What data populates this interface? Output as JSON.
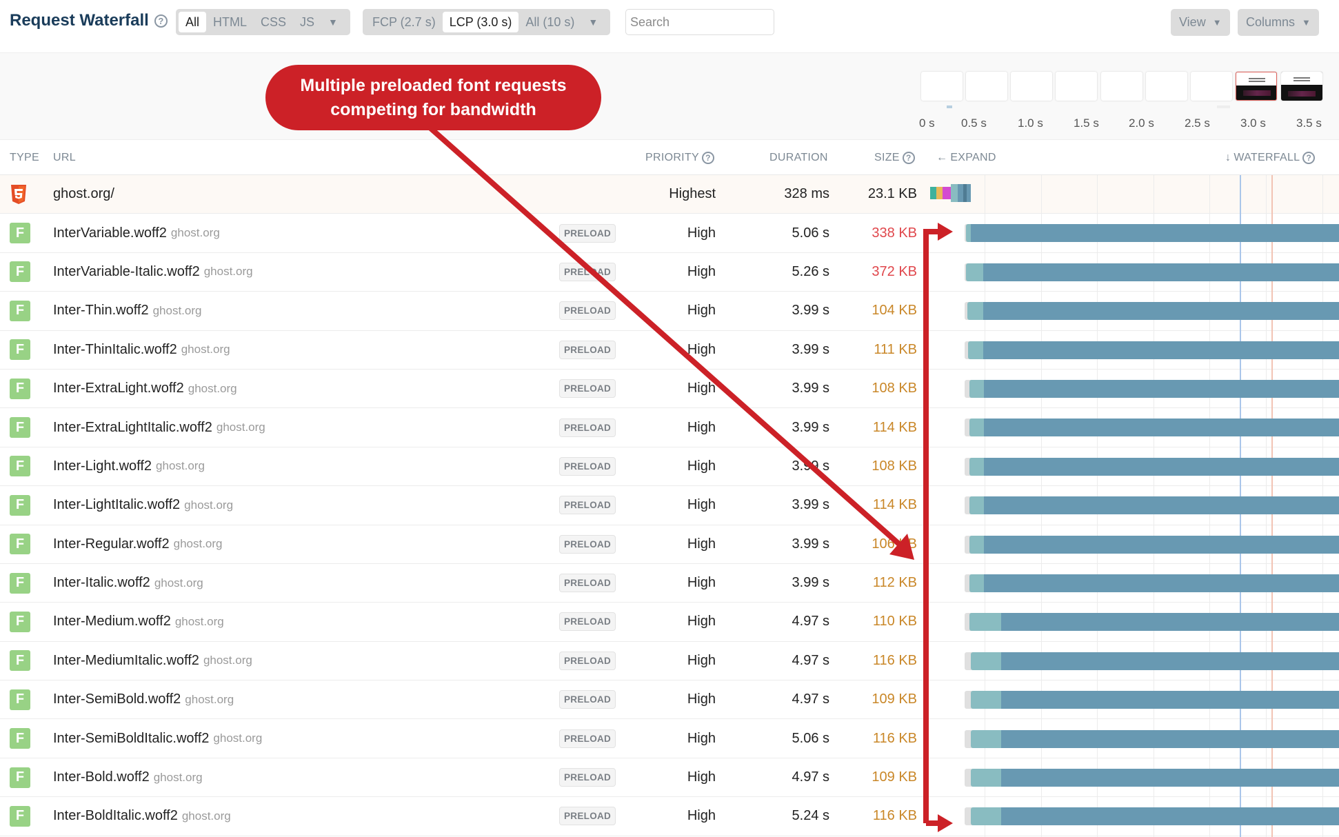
{
  "header": {
    "title": "Request Waterfall",
    "type_filters": [
      "All",
      "HTML",
      "CSS",
      "JS"
    ],
    "type_filter_active": "All",
    "time_filters": [
      "FCP (2.7 s)",
      "LCP (3.0 s)",
      "All (10 s)"
    ],
    "time_filter_active": "LCP (3.0 s)",
    "search_placeholder": "Search",
    "view_label": "View",
    "columns_label": "Columns"
  },
  "filmstrip": {
    "ticks": [
      "0 s",
      "0.5 s",
      "1.0 s",
      "1.5 s",
      "2.0 s",
      "2.5 s",
      "3.0 s",
      "3.5 s"
    ],
    "frames": [
      "blank",
      "blank",
      "blank",
      "blank",
      "blank",
      "blank",
      "blank",
      "screenshot-lcp",
      "screenshot"
    ]
  },
  "columns": {
    "type": "TYPE",
    "url": "URL",
    "priority": "PRIORITY",
    "duration": "DURATION",
    "size": "SIZE",
    "expand": "EXPAND",
    "waterfall": "WATERFALL"
  },
  "colors": {
    "annotation": "#cc2127",
    "size_large": "#e0474c",
    "size_medium": "#c98728",
    "bar_connect": "#89bcc1",
    "bar_download": "#6899b2",
    "fcp_line": "#aac6ea",
    "lcp_line": "#f2c4b4"
  },
  "waterfall": {
    "axis_max_s": 3.6,
    "fcp_s": 2.7,
    "lcp_s": 3.0
  },
  "rows": [
    {
      "type": "html",
      "name": "ghost.org/",
      "host": "",
      "badge": "",
      "priority": "Highest",
      "duration": "328 ms",
      "size": "23.1 KB",
      "size_level": "normal",
      "start_s": 0.0,
      "wait_s": 0.0,
      "connect_s": 0.19,
      "end_s": 0.33
    },
    {
      "type": "font",
      "name": "InterVariable.woff2",
      "host": "ghost.org",
      "badge": "PRELOAD",
      "priority": "High",
      "duration": "5.06 s",
      "size": "338 KB",
      "size_level": "large",
      "start_s": 0.32,
      "wait_s": 0.32,
      "connect_s": 0.36,
      "end_s": 5.38
    },
    {
      "type": "font",
      "name": "InterVariable-Italic.woff2",
      "host": "ghost.org",
      "badge": "PRELOAD",
      "priority": "High",
      "duration": "5.26 s",
      "size": "372 KB",
      "size_level": "large",
      "start_s": 0.32,
      "wait_s": 0.32,
      "connect_s": 0.47,
      "end_s": 5.58
    },
    {
      "type": "font",
      "name": "Inter-Thin.woff2",
      "host": "ghost.org",
      "badge": "PRELOAD",
      "priority": "High",
      "duration": "3.99 s",
      "size": "104 KB",
      "size_level": "medium",
      "start_s": 0.32,
      "wait_s": 0.33,
      "connect_s": 0.47,
      "end_s": 4.32
    },
    {
      "type": "font",
      "name": "Inter-ThinItalic.woff2",
      "host": "ghost.org",
      "badge": "PRELOAD",
      "priority": "High",
      "duration": "3.99 s",
      "size": "111 KB",
      "size_level": "medium",
      "start_s": 0.32,
      "wait_s": 0.34,
      "connect_s": 0.47,
      "end_s": 4.32
    },
    {
      "type": "font",
      "name": "Inter-ExtraLight.woff2",
      "host": "ghost.org",
      "badge": "PRELOAD",
      "priority": "High",
      "duration": "3.99 s",
      "size": "108 KB",
      "size_level": "medium",
      "start_s": 0.32,
      "wait_s": 0.35,
      "connect_s": 0.48,
      "end_s": 4.32
    },
    {
      "type": "font",
      "name": "Inter-ExtraLightItalic.woff2",
      "host": "ghost.org",
      "badge": "PRELOAD",
      "priority": "High",
      "duration": "3.99 s",
      "size": "114 KB",
      "size_level": "medium",
      "start_s": 0.32,
      "wait_s": 0.35,
      "connect_s": 0.48,
      "end_s": 4.32
    },
    {
      "type": "font",
      "name": "Inter-Light.woff2",
      "host": "ghost.org",
      "badge": "PRELOAD",
      "priority": "High",
      "duration": "3.99 s",
      "size": "108 KB",
      "size_level": "medium",
      "start_s": 0.32,
      "wait_s": 0.35,
      "connect_s": 0.48,
      "end_s": 4.32
    },
    {
      "type": "font",
      "name": "Inter-LightItalic.woff2",
      "host": "ghost.org",
      "badge": "PRELOAD",
      "priority": "High",
      "duration": "3.99 s",
      "size": "114 KB",
      "size_level": "medium",
      "start_s": 0.32,
      "wait_s": 0.35,
      "connect_s": 0.48,
      "end_s": 4.32
    },
    {
      "type": "font",
      "name": "Inter-Regular.woff2",
      "host": "ghost.org",
      "badge": "PRELOAD",
      "priority": "High",
      "duration": "3.99 s",
      "size": "106 KB",
      "size_level": "medium",
      "start_s": 0.32,
      "wait_s": 0.35,
      "connect_s": 0.48,
      "end_s": 4.32
    },
    {
      "type": "font",
      "name": "Inter-Italic.woff2",
      "host": "ghost.org",
      "badge": "PRELOAD",
      "priority": "High",
      "duration": "3.99 s",
      "size": "112 KB",
      "size_level": "medium",
      "start_s": 0.32,
      "wait_s": 0.35,
      "connect_s": 0.48,
      "end_s": 4.32
    },
    {
      "type": "font",
      "name": "Inter-Medium.woff2",
      "host": "ghost.org",
      "badge": "PRELOAD",
      "priority": "High",
      "duration": "4.97 s",
      "size": "110 KB",
      "size_level": "medium",
      "start_s": 0.32,
      "wait_s": 0.35,
      "connect_s": 0.63,
      "end_s": 5.32
    },
    {
      "type": "font",
      "name": "Inter-MediumItalic.woff2",
      "host": "ghost.org",
      "badge": "PRELOAD",
      "priority": "High",
      "duration": "4.97 s",
      "size": "116 KB",
      "size_level": "medium",
      "start_s": 0.32,
      "wait_s": 0.36,
      "connect_s": 0.63,
      "end_s": 5.33
    },
    {
      "type": "font",
      "name": "Inter-SemiBold.woff2",
      "host": "ghost.org",
      "badge": "PRELOAD",
      "priority": "High",
      "duration": "4.97 s",
      "size": "109 KB",
      "size_level": "medium",
      "start_s": 0.32,
      "wait_s": 0.36,
      "connect_s": 0.63,
      "end_s": 5.33
    },
    {
      "type": "font",
      "name": "Inter-SemiBoldItalic.woff2",
      "host": "ghost.org",
      "badge": "PRELOAD",
      "priority": "High",
      "duration": "5.06 s",
      "size": "116 KB",
      "size_level": "medium",
      "start_s": 0.32,
      "wait_s": 0.36,
      "connect_s": 0.63,
      "end_s": 5.42
    },
    {
      "type": "font",
      "name": "Inter-Bold.woff2",
      "host": "ghost.org",
      "badge": "PRELOAD",
      "priority": "High",
      "duration": "4.97 s",
      "size": "109 KB",
      "size_level": "medium",
      "start_s": 0.32,
      "wait_s": 0.36,
      "connect_s": 0.63,
      "end_s": 5.33
    },
    {
      "type": "font",
      "name": "Inter-BoldItalic.woff2",
      "host": "ghost.org",
      "badge": "PRELOAD",
      "priority": "High",
      "duration": "5.24 s",
      "size": "116 KB",
      "size_level": "medium",
      "start_s": 0.32,
      "wait_s": 0.36,
      "connect_s": 0.63,
      "end_s": 5.6
    }
  ],
  "annotation": {
    "text": "Multiple preloaded font requests competing for bandwidth"
  }
}
